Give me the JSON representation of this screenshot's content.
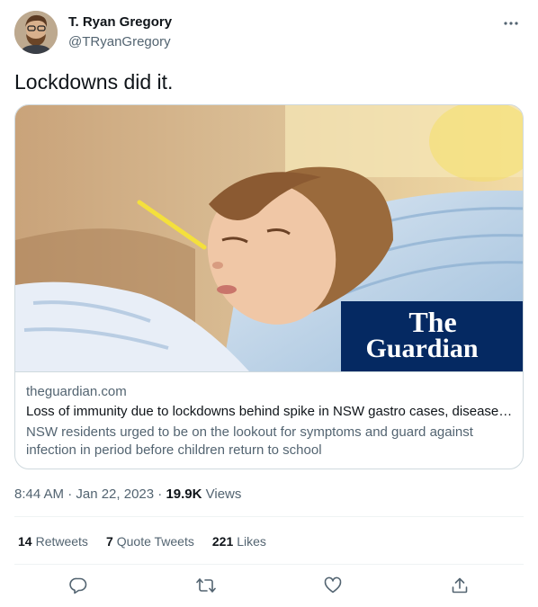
{
  "tweet": {
    "author_name": "T. Ryan Gregory",
    "author_handle": "@TRyanGregory",
    "text": "Lockdowns did it.",
    "timestamp": "8:44 AM · Jan 22, 2023 · ",
    "views_count": "19.9K",
    "views_label": " Views"
  },
  "card": {
    "logo_line1": "The",
    "logo_line2": "Guardian",
    "domain": "theguardian.com",
    "title": "Loss of immunity due to lockdowns behind spike in NSW gastro cases, diseases …",
    "description": "NSW residents urged to be on the lookout for symptoms and guard against infection in period before children return to school"
  },
  "stats": {
    "retweets_count": "14",
    "retweets_label": "Retweets",
    "quotes_count": "7",
    "quotes_label": "Quote Tweets",
    "likes_count": "221",
    "likes_label": "Likes"
  },
  "icons": {
    "more": "more-icon",
    "reply": "reply-icon",
    "retweet": "retweet-icon",
    "like": "heart-icon",
    "share": "share-icon"
  },
  "colors": {
    "text_primary": "#0f1419",
    "text_secondary": "#536471",
    "border": "#cfd9de",
    "guardian_blue": "#052962"
  }
}
